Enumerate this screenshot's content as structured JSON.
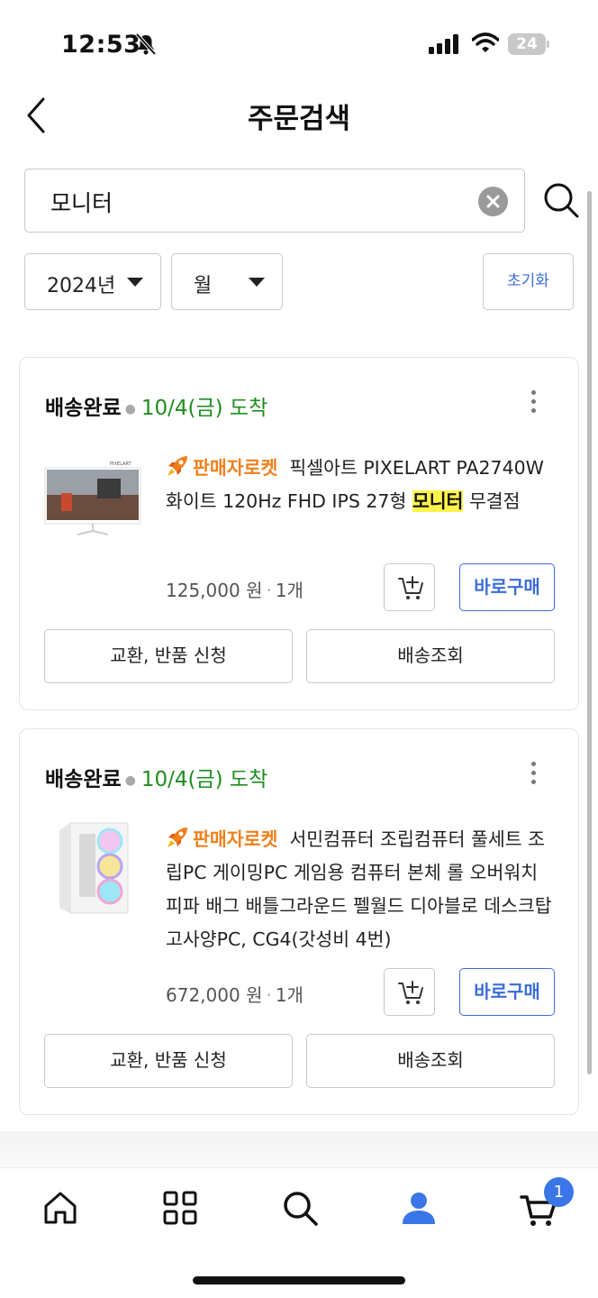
{
  "status_bar": {
    "time": "12:53",
    "battery": "24"
  },
  "header": {
    "title": "주문검색"
  },
  "search": {
    "query": "모니터"
  },
  "filters": {
    "year": "2024년",
    "month": "월",
    "reset_label": "초기화"
  },
  "orders": [
    {
      "status": "배송완료",
      "arrival": "10/4(금) 도착",
      "badge": "판매자로켓",
      "title_before": "픽셀아트 PIXELART PA2740W 화이트 120Hz FHD IPS 27형 ",
      "highlight": "모니터",
      "title_after": " 무결점",
      "price": "125,000 원",
      "qty": "1개",
      "buy_label": "바로구매",
      "exchange_label": "교환, 반품 신청",
      "tracking_label": "배송조회",
      "thumb_brand": "PIXELART"
    },
    {
      "status": "배송완료",
      "arrival": "10/4(금) 도착",
      "badge": "판매자로켓",
      "title_before": "서민컴퓨터 조립컴퓨터 풀세트 조립PC 게이밍PC 게임용 컴퓨터 본체 롤 오버워치 피파 배그 배틀그라운드 펠월드 디아블로 데스크탑 고사양PC, CG4(갓성비 4번)",
      "highlight": "",
      "title_after": "",
      "price": "672,000 원",
      "qty": "1개",
      "buy_label": "바로구매",
      "exchange_label": "교환, 반품 신청",
      "tracking_label": "배송조회"
    }
  ],
  "bottom_nav": {
    "items": [
      "home-icon",
      "category-icon",
      "search-icon",
      "my-page-icon",
      "cart-icon"
    ],
    "cart_count": "1"
  },
  "colors": {
    "accent": "#3b6dd8",
    "arrival_green": "#1e8d1e",
    "badge_orange": "#f07f1a",
    "highlight": "#fdf34b"
  }
}
